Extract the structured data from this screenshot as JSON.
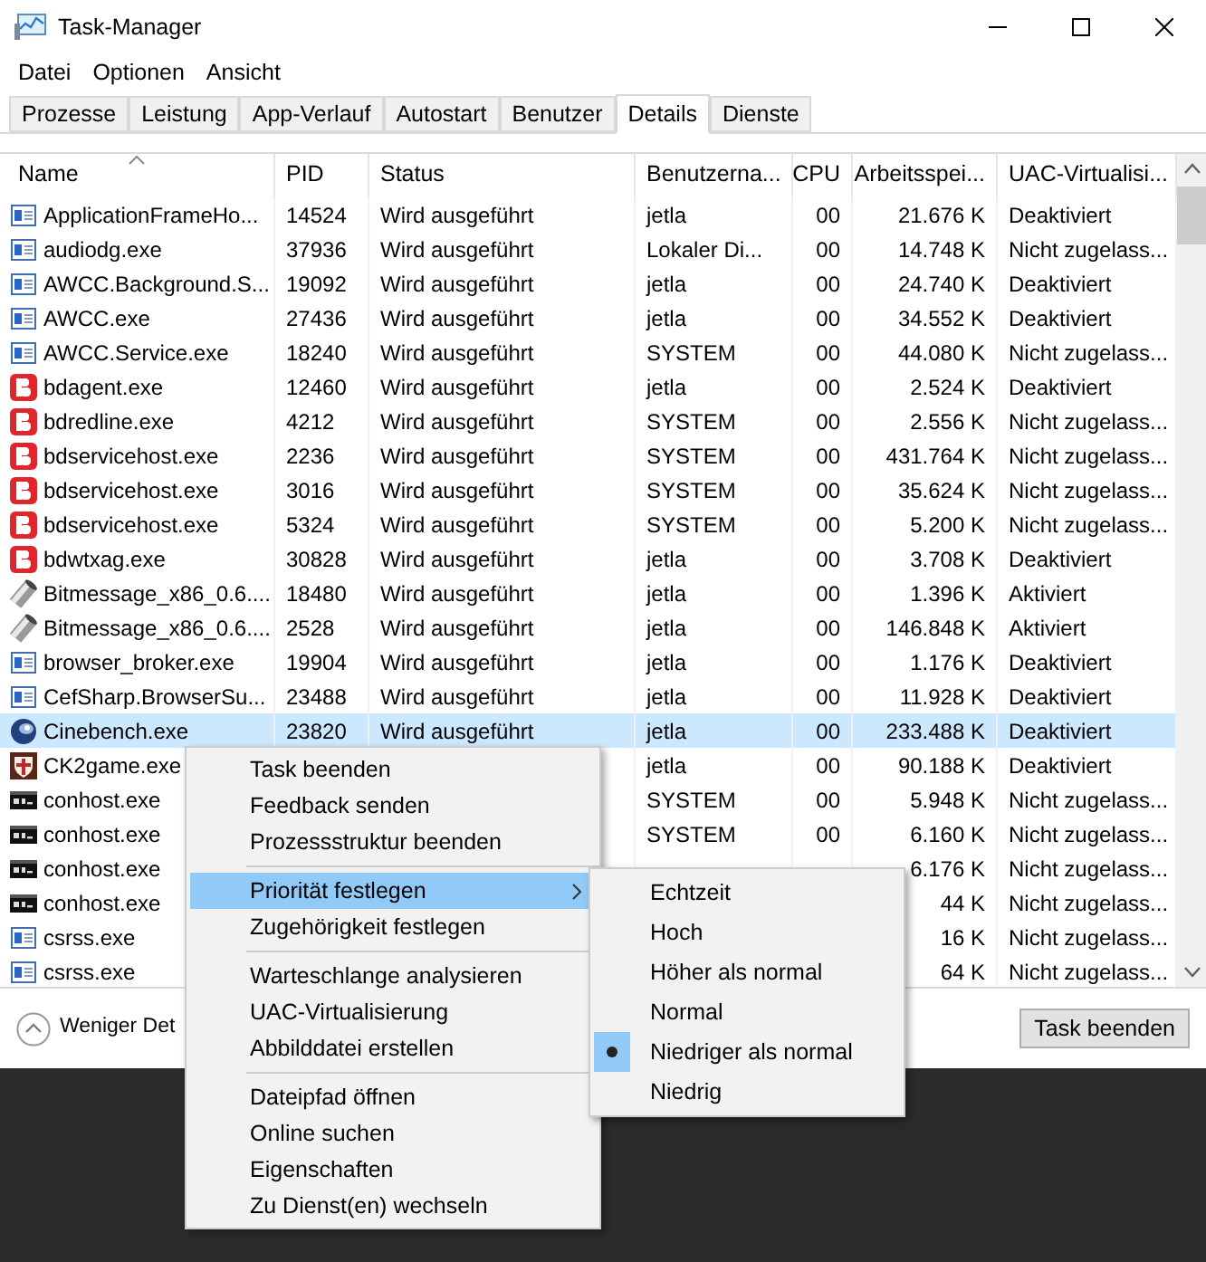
{
  "window": {
    "title": "Task-Manager"
  },
  "menu_bar": [
    "Datei",
    "Optionen",
    "Ansicht"
  ],
  "tabs": [
    {
      "label": "Prozesse",
      "selected": false
    },
    {
      "label": "Leistung",
      "selected": false
    },
    {
      "label": "App-Verlauf",
      "selected": false
    },
    {
      "label": "Autostart",
      "selected": false
    },
    {
      "label": "Benutzer",
      "selected": false
    },
    {
      "label": "Details",
      "selected": true
    },
    {
      "label": "Dienste",
      "selected": false
    }
  ],
  "table": {
    "columns": [
      "Name",
      "PID",
      "Status",
      "Benutzerna...",
      "CPU",
      "Arbeitsspei...",
      "UAC-Virtualisi..."
    ],
    "rows": [
      {
        "kind": "window",
        "name": "ApplicationFrameHo...",
        "pid": "14524",
        "status": "Wird ausgeführt",
        "user": "jetla",
        "cpu": "00",
        "memory": "21.676 K",
        "uac": "Deaktiviert",
        "selected": false
      },
      {
        "kind": "window",
        "name": "audiodg.exe",
        "pid": "37936",
        "status": "Wird ausgeführt",
        "user": "Lokaler Di...",
        "cpu": "00",
        "memory": "14.748 K",
        "uac": "Nicht zugelass...",
        "selected": false
      },
      {
        "kind": "window",
        "name": "AWCC.Background.S...",
        "pid": "19092",
        "status": "Wird ausgeführt",
        "user": "jetla",
        "cpu": "00",
        "memory": "24.740 K",
        "uac": "Deaktiviert",
        "selected": false
      },
      {
        "kind": "window",
        "name": "AWCC.exe",
        "pid": "27436",
        "status": "Wird ausgeführt",
        "user": "jetla",
        "cpu": "00",
        "memory": "34.552 K",
        "uac": "Deaktiviert",
        "selected": false
      },
      {
        "kind": "window",
        "name": "AWCC.Service.exe",
        "pid": "18240",
        "status": "Wird ausgeführt",
        "user": "SYSTEM",
        "cpu": "00",
        "memory": "44.080 K",
        "uac": "Nicht zugelass...",
        "selected": false
      },
      {
        "kind": "tile",
        "name": "bdagent.exe",
        "pid": "12460",
        "status": "Wird ausgeführt",
        "user": "jetla",
        "cpu": "00",
        "memory": "2.524 K",
        "uac": "Deaktiviert",
        "selected": false
      },
      {
        "kind": "tile",
        "name": "bdredline.exe",
        "pid": "4212",
        "status": "Wird ausgeführt",
        "user": "SYSTEM",
        "cpu": "00",
        "memory": "2.556 K",
        "uac": "Nicht zugelass...",
        "selected": false
      },
      {
        "kind": "tile",
        "name": "bdservicehost.exe",
        "pid": "2236",
        "status": "Wird ausgeführt",
        "user": "SYSTEM",
        "cpu": "00",
        "memory": "431.764 K",
        "uac": "Nicht zugelass...",
        "selected": false
      },
      {
        "kind": "tile",
        "name": "bdservicehost.exe",
        "pid": "3016",
        "status": "Wird ausgeführt",
        "user": "SYSTEM",
        "cpu": "00",
        "memory": "35.624 K",
        "uac": "Nicht zugelass...",
        "selected": false
      },
      {
        "kind": "tile",
        "name": "bdservicehost.exe",
        "pid": "5324",
        "status": "Wird ausgeführt",
        "user": "SYSTEM",
        "cpu": "00",
        "memory": "5.200 K",
        "uac": "Nicht zugelass...",
        "selected": false
      },
      {
        "kind": "tile",
        "name": "bdwtxag.exe",
        "pid": "30828",
        "status": "Wird ausgeführt",
        "user": "jetla",
        "cpu": "00",
        "memory": "3.708 K",
        "uac": "Deaktiviert",
        "selected": false
      },
      {
        "kind": "cylinder",
        "name": "Bitmessage_x86_0.6....",
        "pid": "18480",
        "status": "Wird ausgeführt",
        "user": "jetla",
        "cpu": "00",
        "memory": "1.396 K",
        "uac": "Aktiviert",
        "selected": false
      },
      {
        "kind": "cylinder",
        "name": "Bitmessage_x86_0.6....",
        "pid": "2528",
        "status": "Wird ausgeführt",
        "user": "jetla",
        "cpu": "00",
        "memory": "146.848 K",
        "uac": "Aktiviert",
        "selected": false
      },
      {
        "kind": "window",
        "name": "browser_broker.exe",
        "pid": "19904",
        "status": "Wird ausgeführt",
        "user": "jetla",
        "cpu": "00",
        "memory": "1.176 K",
        "uac": "Deaktiviert",
        "selected": false
      },
      {
        "kind": "window",
        "name": "CefSharp.BrowserSu...",
        "pid": "23488",
        "status": "Wird ausgeführt",
        "user": "jetla",
        "cpu": "00",
        "memory": "11.928 K",
        "uac": "Deaktiviert",
        "selected": false
      },
      {
        "kind": "sphere",
        "name": "Cinebench.exe",
        "pid": "23820",
        "status": "Wird ausgeführt",
        "user": "jetla",
        "cpu": "00",
        "memory": "233.488 K",
        "uac": "Deaktiviert",
        "selected": true
      },
      {
        "kind": "shield",
        "name": "CK2game.exe",
        "user": "jetla",
        "cpu": "00",
        "memory": "90.188 K",
        "uac": "Deaktiviert",
        "selected": false
      },
      {
        "kind": "console",
        "name": "conhost.exe",
        "user": "SYSTEM",
        "cpu": "00",
        "memory": "5.948 K",
        "uac": "Nicht zugelass...",
        "selected": false
      },
      {
        "kind": "console",
        "name": "conhost.exe",
        "user": "SYSTEM",
        "cpu": "00",
        "memory": "6.160 K",
        "uac": "Nicht zugelass...",
        "selected": false
      },
      {
        "kind": "console",
        "name": "conhost.exe",
        "memory": "6.176 K",
        "uac": "Nicht zugelass...",
        "selected": false
      },
      {
        "kind": "console",
        "name": "conhost.exe",
        "memory": "44 K",
        "uac": "Nicht zugelass...",
        "selected": false
      },
      {
        "kind": "window",
        "name": "csrss.exe",
        "memory": "16 K",
        "uac": "Nicht zugelass...",
        "selected": false
      },
      {
        "kind": "window",
        "name": "csrss.exe",
        "memory": "64 K",
        "uac": "Nicht zugelass...",
        "selected": false
      }
    ]
  },
  "footer": {
    "toggle": "Weniger Det",
    "button": "Task beenden"
  },
  "context_menu": {
    "items": [
      {
        "kind": "item",
        "label": "Task beenden",
        "highlighted": false,
        "submenu": false
      },
      {
        "kind": "item",
        "label": "Feedback senden",
        "highlighted": false,
        "submenu": false
      },
      {
        "kind": "item",
        "label": "Prozessstruktur beenden",
        "highlighted": false,
        "submenu": false
      },
      {
        "kind": "separator"
      },
      {
        "kind": "item",
        "label": "Priorität festlegen",
        "highlighted": true,
        "submenu": true
      },
      {
        "kind": "item",
        "label": "Zugehörigkeit festlegen",
        "highlighted": false,
        "submenu": false
      },
      {
        "kind": "separator"
      },
      {
        "kind": "item",
        "label": "Warteschlange analysieren",
        "highlighted": false,
        "submenu": false
      },
      {
        "kind": "item",
        "label": "UAC-Virtualisierung",
        "highlighted": false,
        "submenu": false
      },
      {
        "kind": "item",
        "label": "Abbilddatei erstellen",
        "highlighted": false,
        "submenu": false
      },
      {
        "kind": "separator"
      },
      {
        "kind": "item",
        "label": "Dateipfad öffnen",
        "highlighted": false,
        "submenu": false
      },
      {
        "kind": "item",
        "label": "Online suchen",
        "highlighted": false,
        "submenu": false
      },
      {
        "kind": "item",
        "label": "Eigenschaften",
        "highlighted": false,
        "submenu": false
      },
      {
        "kind": "item",
        "label": "Zu Dienst(en) wechseln",
        "highlighted": false,
        "submenu": false
      }
    ]
  },
  "priority_submenu": {
    "items": [
      {
        "label": "Echtzeit",
        "selected": false
      },
      {
        "label": "Hoch",
        "selected": false
      },
      {
        "label": "Höher als normal",
        "selected": false
      },
      {
        "label": "Normal",
        "selected": false
      },
      {
        "label": "Niedriger als normal",
        "selected": true
      },
      {
        "label": "Niedrig",
        "selected": false
      }
    ]
  }
}
